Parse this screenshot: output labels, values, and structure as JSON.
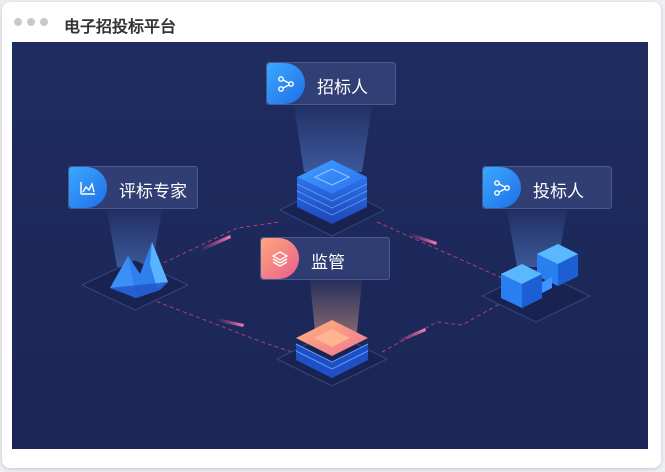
{
  "window": {
    "title": "电子招投标平台",
    "dot_color": "#c9c9c9"
  },
  "canvas": {
    "background": "#1e2a5c"
  },
  "nodes": {
    "bidder_inviter": {
      "label": "招标人",
      "icon": "share-nodes-icon"
    },
    "expert": {
      "label": "评标专家",
      "icon": "chart-mountain-icon"
    },
    "bidder": {
      "label": "投标人",
      "icon": "share-nodes-icon"
    },
    "supervision": {
      "label": "监管",
      "icon": "layers-icon"
    }
  },
  "colors": {
    "blue_icon": "#2b9bf0",
    "pink_icon": "#f2708a",
    "connector": "#c2447f"
  }
}
